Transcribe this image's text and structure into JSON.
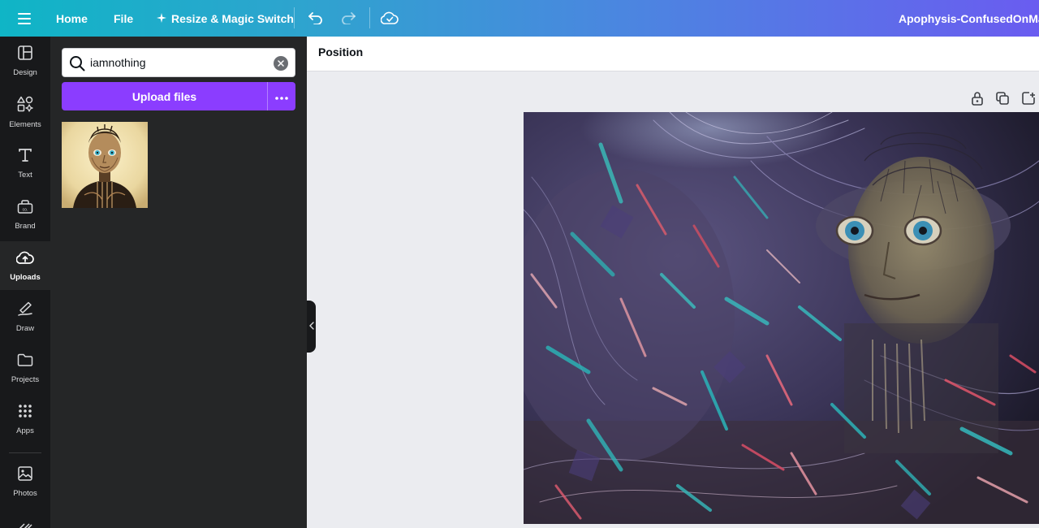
{
  "topbar": {
    "home_label": "Home",
    "file_label": "File",
    "resize_label": "Resize & Magic Switch",
    "doc_title": "Apophysis-ConfusedOnMany",
    "gradient_start": "#0fb5c6",
    "gradient_end": "#6a5cf0"
  },
  "rail": {
    "items": [
      {
        "label": "Design",
        "icon": "design-icon"
      },
      {
        "label": "Elements",
        "icon": "elements-icon"
      },
      {
        "label": "Text",
        "icon": "text-icon"
      },
      {
        "label": "Brand",
        "icon": "brand-icon"
      },
      {
        "label": "Uploads",
        "icon": "upload-cloud-icon",
        "active": true
      },
      {
        "label": "Draw",
        "icon": "draw-icon"
      },
      {
        "label": "Projects",
        "icon": "folder-icon"
      },
      {
        "label": "Apps",
        "icon": "apps-grid-icon"
      },
      {
        "label": "Photos",
        "icon": "photos-icon"
      }
    ]
  },
  "panel": {
    "search_value": "iamnothing",
    "upload_label": "Upload files",
    "accent": "#8b3dff"
  },
  "toolbar": {
    "position_label": "Position"
  }
}
